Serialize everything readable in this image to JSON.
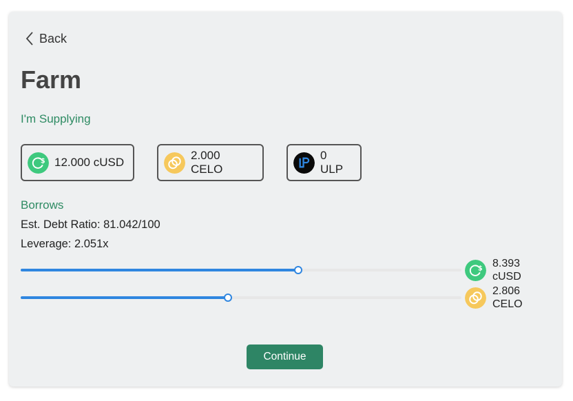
{
  "nav": {
    "back_label": "Back"
  },
  "page": {
    "title": "Farm"
  },
  "supplying": {
    "label": "I'm Supplying",
    "items": [
      {
        "amount": "12.000 cUSD",
        "icon": "cusd-coin-icon"
      },
      {
        "amount": "2.000 CELO",
        "icon": "celo-coin-icon"
      },
      {
        "amount": "0 ULP",
        "icon": "ulp-token-icon"
      }
    ]
  },
  "borrows": {
    "label": "Borrows",
    "debt_ratio": "Est. Debt Ratio: 81.042/100",
    "leverage": "Leverage: 2.051x",
    "sliders": [
      {
        "level": 0.63,
        "value": "8.393",
        "unit": "cUSD",
        "icon": "cusd-coin-icon"
      },
      {
        "level": 0.47,
        "value": "2.806",
        "unit": "CELO",
        "icon": "celo-coin-icon"
      }
    ]
  },
  "actions": {
    "continue_label": "Continue"
  },
  "colors": {
    "accent_green": "#2e8b63",
    "slider_blue": "#2f86e0",
    "cusd_green": "#3ec97e",
    "celo_gold": "#f6c85c",
    "button_green": "#2e8565"
  }
}
